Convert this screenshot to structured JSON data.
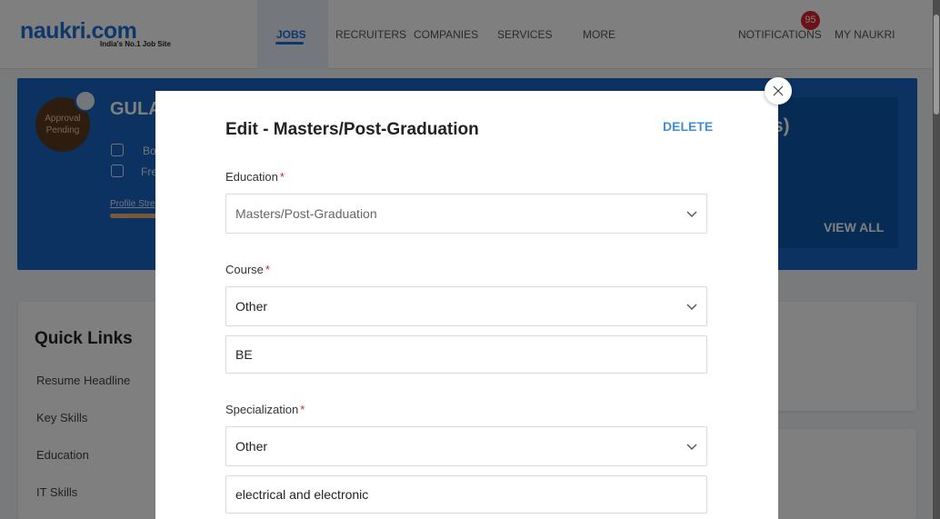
{
  "header": {
    "logo_text": "naukri.com",
    "logo_tagline": "India's No.1 Job Site",
    "nav": [
      {
        "label": "JOBS",
        "active": true
      },
      {
        "label": "RECRUITERS"
      },
      {
        "label": "COMPANIES"
      },
      {
        "label": "SERVICES"
      },
      {
        "label": "MORE"
      }
    ],
    "notifications_label": "NOTIFICATIONS",
    "notifications_count": "95",
    "my_naukri_label": "MY NAUKRI",
    "brand_color": "#1d6fd6"
  },
  "profile_banner": {
    "name": "GULA",
    "avatar_status": "Approval Pending",
    "location_line": "Bo",
    "experience_line": "Fre",
    "profile_strength_label": "Profile Stre",
    "pending_title": "s)",
    "view_all_label": "VIEW ALL",
    "banner_color": "#1665c1"
  },
  "quick_links": {
    "title": "Quick Links",
    "items": [
      "Resume Headline",
      "Key Skills",
      "Education",
      "IT Skills"
    ]
  },
  "modal": {
    "title": "Edit - Masters/Post-Graduation",
    "delete_label": "DELETE",
    "education": {
      "label": "Education",
      "value": "Masters/Post-Graduation"
    },
    "course": {
      "label": "Course",
      "value": "Other",
      "other_value": "BE"
    },
    "specialization": {
      "label": "Specialization",
      "value": "Other",
      "other_value": "electrical and electronic"
    },
    "required_marker": "*",
    "accent_color": "#3f8fd2"
  }
}
